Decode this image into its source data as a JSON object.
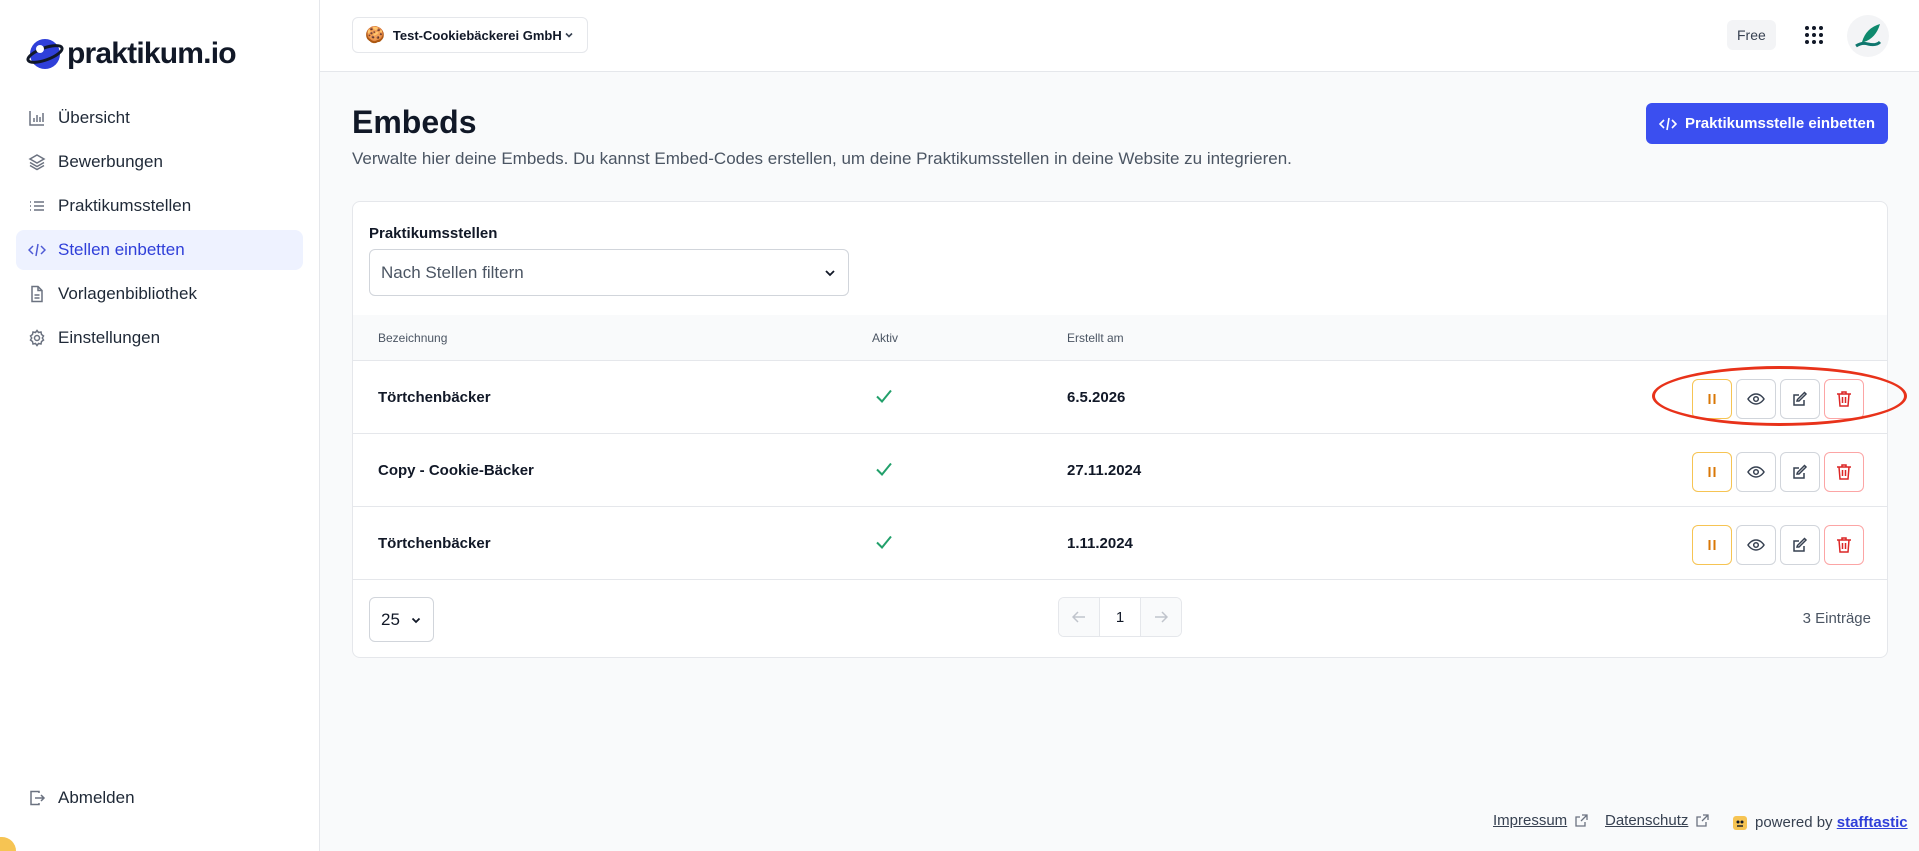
{
  "brand": {
    "name": "praktikum.io"
  },
  "sidebar": {
    "items": [
      {
        "label": "Übersicht",
        "icon": "bar-chart-icon"
      },
      {
        "label": "Bewerbungen",
        "icon": "layers-icon"
      },
      {
        "label": "Praktikumsstellen",
        "icon": "list-icon"
      },
      {
        "label": "Stellen einbetten",
        "icon": "code-icon",
        "active": true
      },
      {
        "label": "Vorlagenbibliothek",
        "icon": "document-icon"
      },
      {
        "label": "Einstellungen",
        "icon": "gear-icon"
      }
    ],
    "logout_label": "Abmelden"
  },
  "topbar": {
    "company": "Test-Cookiebäckerei GmbH",
    "company_icon": "🍪",
    "plan": "Free"
  },
  "page": {
    "title": "Embeds",
    "subtitle": "Verwalte hier deine Embeds. Du kannst Embed-Codes erstellen, um deine Praktikumsstellen in deine Website zu integrieren.",
    "primary_button": "Praktikumsstelle einbetten"
  },
  "filter": {
    "label": "Praktikumsstellen",
    "placeholder": "Nach Stellen filtern"
  },
  "table": {
    "columns": [
      "Bezeichnung",
      "Aktiv",
      "Erstellt am"
    ],
    "rows": [
      {
        "name": "Törtchenbäcker",
        "active": "✓",
        "created": "6.5.2026"
      },
      {
        "name": "Copy - Cookie-Bäcker",
        "active": "✓",
        "created": "27.11.2024"
      },
      {
        "name": "Törtchenbäcker",
        "active": "✓",
        "created": "1.11.2024"
      }
    ]
  },
  "pagination": {
    "per_page": "25",
    "current_page": "1",
    "total": "3 Einträge"
  },
  "footer": {
    "impressum": "Impressum",
    "datenschutz": "Datenschutz",
    "powered_by": "powered by",
    "powered_brand": "stafftastic"
  },
  "colors": {
    "accent": "#3b4ff0",
    "active_nav_bg": "#eef2ff",
    "success": "#22a06b",
    "danger": "#dc2626",
    "warning": "#d97706",
    "highlight": "#e8321a"
  }
}
